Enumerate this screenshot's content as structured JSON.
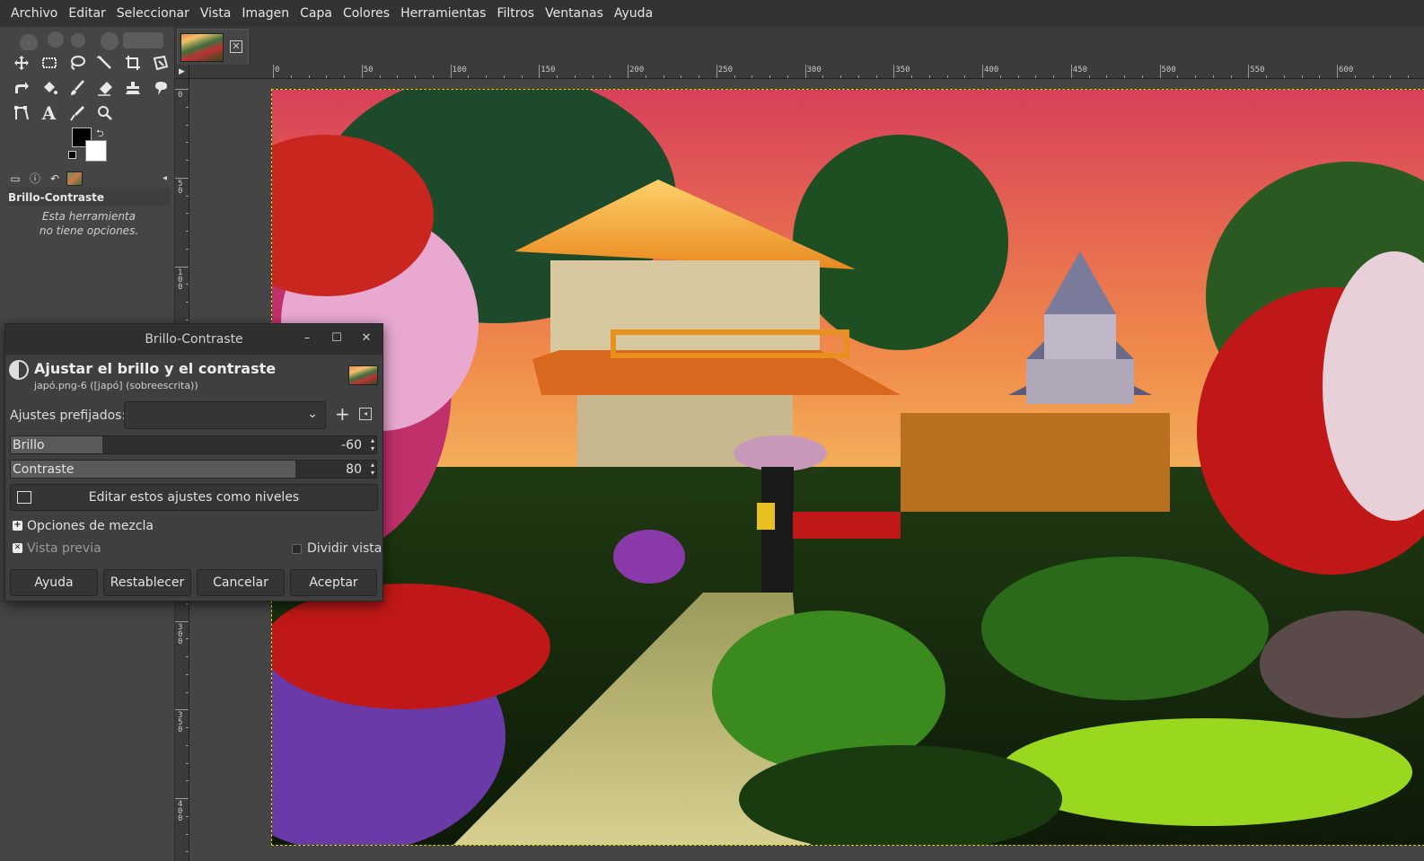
{
  "menubar": {
    "items": [
      "Archivo",
      "Editar",
      "Seleccionar",
      "Vista",
      "Imagen",
      "Capa",
      "Colores",
      "Herramientas",
      "Filtros",
      "Ventanas",
      "Ayuda"
    ]
  },
  "toolbox": {
    "tools": [
      "move-tool",
      "rect-select-tool",
      "free-select-tool",
      "fuzzy-select-tool",
      "crop-tool",
      "unified-transform-tool",
      "warp-tool",
      "bucket-fill-tool",
      "paintbrush-tool",
      "eraser-tool",
      "clone-tool",
      "smudge-tool",
      "paths-tool",
      "text-tool",
      "color-picker-tool",
      "zoom-tool"
    ],
    "fg_color": "#000000",
    "bg_color": "#ffffff"
  },
  "tool_options": {
    "title": "Brillo-Contraste",
    "message_line1": "Esta herramienta",
    "message_line2": "no tiene opciones."
  },
  "rulers": {
    "h_labels": [
      "0",
      "50",
      "100",
      "150",
      "200",
      "250",
      "300",
      "350",
      "400",
      "450",
      "500",
      "550",
      "600"
    ],
    "v_labels": [
      "0",
      "50",
      "100",
      "150",
      "200",
      "250",
      "300",
      "350",
      "400"
    ]
  },
  "dialog": {
    "window_title": "Brillo-Contraste",
    "minimize": "–",
    "maximize": "☐",
    "close": "✕",
    "header_title": "Ajustar el brillo y el contraste",
    "header_subtitle": "japó.png-6 ([japó] (sobreescrita))",
    "presets_label": "Ajustes prefijados:",
    "presets_value": "",
    "brightness": {
      "label": "Brillo",
      "value": "-60",
      "fraction": 0.25
    },
    "contrast": {
      "label": "Contraste",
      "value": "80",
      "fraction": 0.78
    },
    "levels_button": "Editar estos ajustes como niveles",
    "blend_options": "Opciones de mezcla",
    "preview": {
      "label": "Vista previa",
      "checked": true
    },
    "split_view": {
      "label": "Dividir vista",
      "checked": false
    },
    "buttons": {
      "help": "Ayuda",
      "reset": "Restablecer",
      "cancel": "Cancelar",
      "ok": "Aceptar"
    }
  }
}
